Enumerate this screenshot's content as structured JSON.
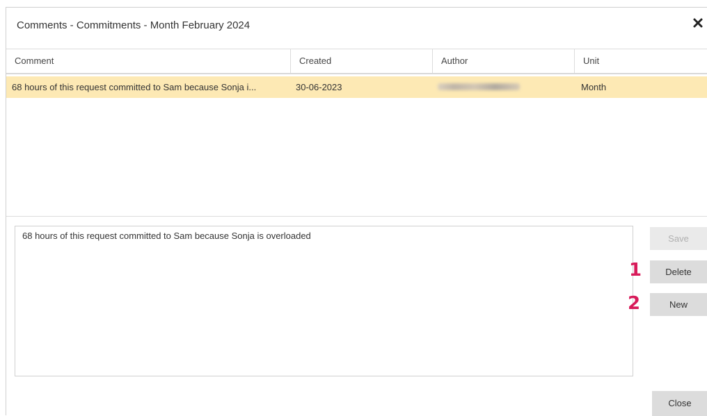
{
  "dialog": {
    "title": "Comments - Commitments - Month February 2024",
    "close_icon": "close-icon"
  },
  "grid": {
    "columns": [
      "Comment",
      "Created",
      "Author",
      "Unit"
    ],
    "rows": [
      {
        "comment": "68 hours of this request committed to Sam because Sonja i...",
        "created": "30-06-2023",
        "author": "",
        "unit": "Month",
        "selected": true
      }
    ]
  },
  "editor": {
    "value": "68 hours of this request committed to Sam because Sonja is overloaded"
  },
  "buttons": {
    "save": "Save",
    "delete": "Delete",
    "new": "New",
    "close": "Close"
  },
  "annotations": {
    "marker_1": "1",
    "marker_2": "2"
  },
  "colors": {
    "selected_row": "#fde9b4",
    "marker": "#d81b5a"
  }
}
